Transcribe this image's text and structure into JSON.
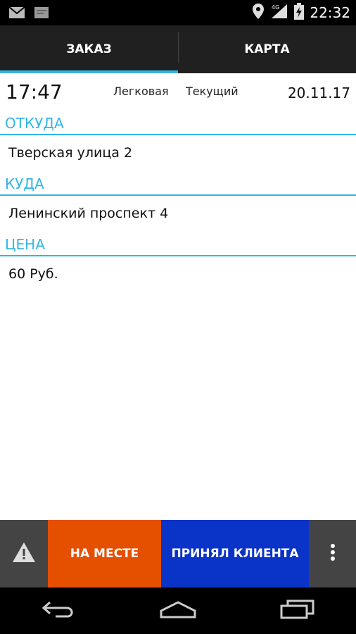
{
  "status_bar": {
    "time": "22:32",
    "icons": [
      "mail-icon",
      "message-icon",
      "location-icon",
      "signal-4g-icon",
      "battery-charging-icon"
    ]
  },
  "tabs": [
    {
      "label": "ЗАКАЗ",
      "active": true
    },
    {
      "label": "КАРТА",
      "active": false
    }
  ],
  "order": {
    "time": "17:47",
    "car_type": "Легковая",
    "status": "Текущий",
    "date": "20.11.17",
    "from_label": "ОТКУДА",
    "from_value": "Тверская улица 2",
    "to_label": "КУДА",
    "to_value": "Ленинский проспект 4",
    "price_label": "ЦЕНА",
    "price_value": "60 Руб."
  },
  "actions": {
    "on_site": "НА МЕСТЕ",
    "accepted": "ПРИНЯЛ КЛИЕНТА"
  },
  "colors": {
    "accent": "#33b5e5",
    "on_site": "#e55000",
    "accepted": "#0a33c8"
  }
}
